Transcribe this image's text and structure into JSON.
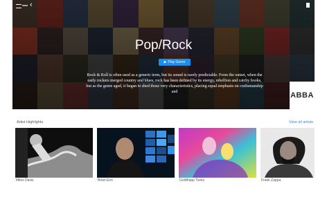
{
  "hero": {
    "title": "Pop/Rock",
    "play_label": "Play Genre",
    "description": "Rock & Roll is often used as a generic term, but its sound is rarely predictable. From the outset, when the early rockers merged country and blues, rock has been defined by its energy, rebellion and catchy hooks, but as the genre aged, it began to shed those very characteristics, placing equal emphasis on craftsmanship and",
    "tile_label": "ABBA"
  },
  "section": {
    "title": "Artist Highlights",
    "view_all": "View all artists"
  },
  "artists": [
    {
      "name": "Miles Davis"
    },
    {
      "name": "Brian Eno"
    },
    {
      "name": "Goldfrapp Twins"
    },
    {
      "name": "Frank Zappa"
    }
  ],
  "colors": {
    "accent": "#1b8ff0",
    "link": "#2a8ee0"
  }
}
